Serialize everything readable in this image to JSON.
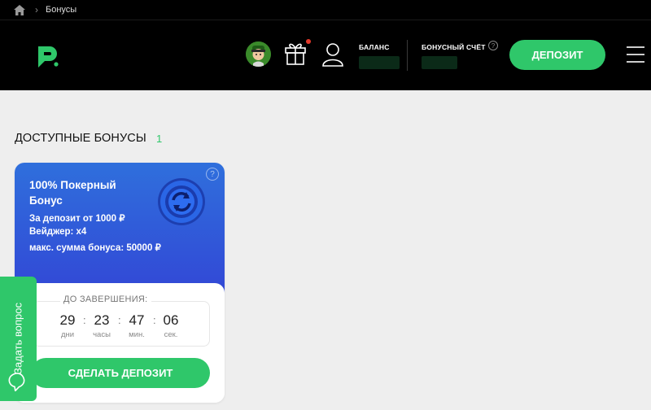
{
  "breadcrumb": {
    "current": "Бонусы"
  },
  "header": {
    "balance_label": "БАЛАНС",
    "bonus_account_label": "БОНУСНЫЙ СЧЁТ",
    "bonus_help": "?",
    "deposit_button": "ДЕПОЗИТ"
  },
  "section": {
    "title": "ДОСТУПНЫЕ БОНУСЫ",
    "count": "1"
  },
  "bonus_card": {
    "title": "100% Покерный Бонус",
    "help": "?",
    "deposit_from": "За депозит от 1000 ₽",
    "wager": "Вейджер:  х4",
    "max_bonus": "макс. сумма бонуса: 50000 ₽",
    "timer_label": "ДО ЗАВЕРШЕНИЯ:",
    "timer": [
      {
        "value": "29",
        "unit": "дни"
      },
      {
        "value": "23",
        "unit": "часы"
      },
      {
        "value": "47",
        "unit": "мин."
      },
      {
        "value": "06",
        "unit": "сек."
      }
    ],
    "colon": ":",
    "cta": "СДЕЛАТЬ ДЕПОЗИТ"
  },
  "side_tab": {
    "label": "Задать вопрос"
  },
  "colors": {
    "accent": "#2fc76a",
    "card_blue": "#3248d6",
    "header_bg": "#000000",
    "page_bg": "#eeeeee"
  },
  "icons": [
    "home-icon",
    "logo-icon",
    "gift-icon",
    "user-icon",
    "menu-icon",
    "refresh-chip-icon",
    "chat-icon"
  ]
}
